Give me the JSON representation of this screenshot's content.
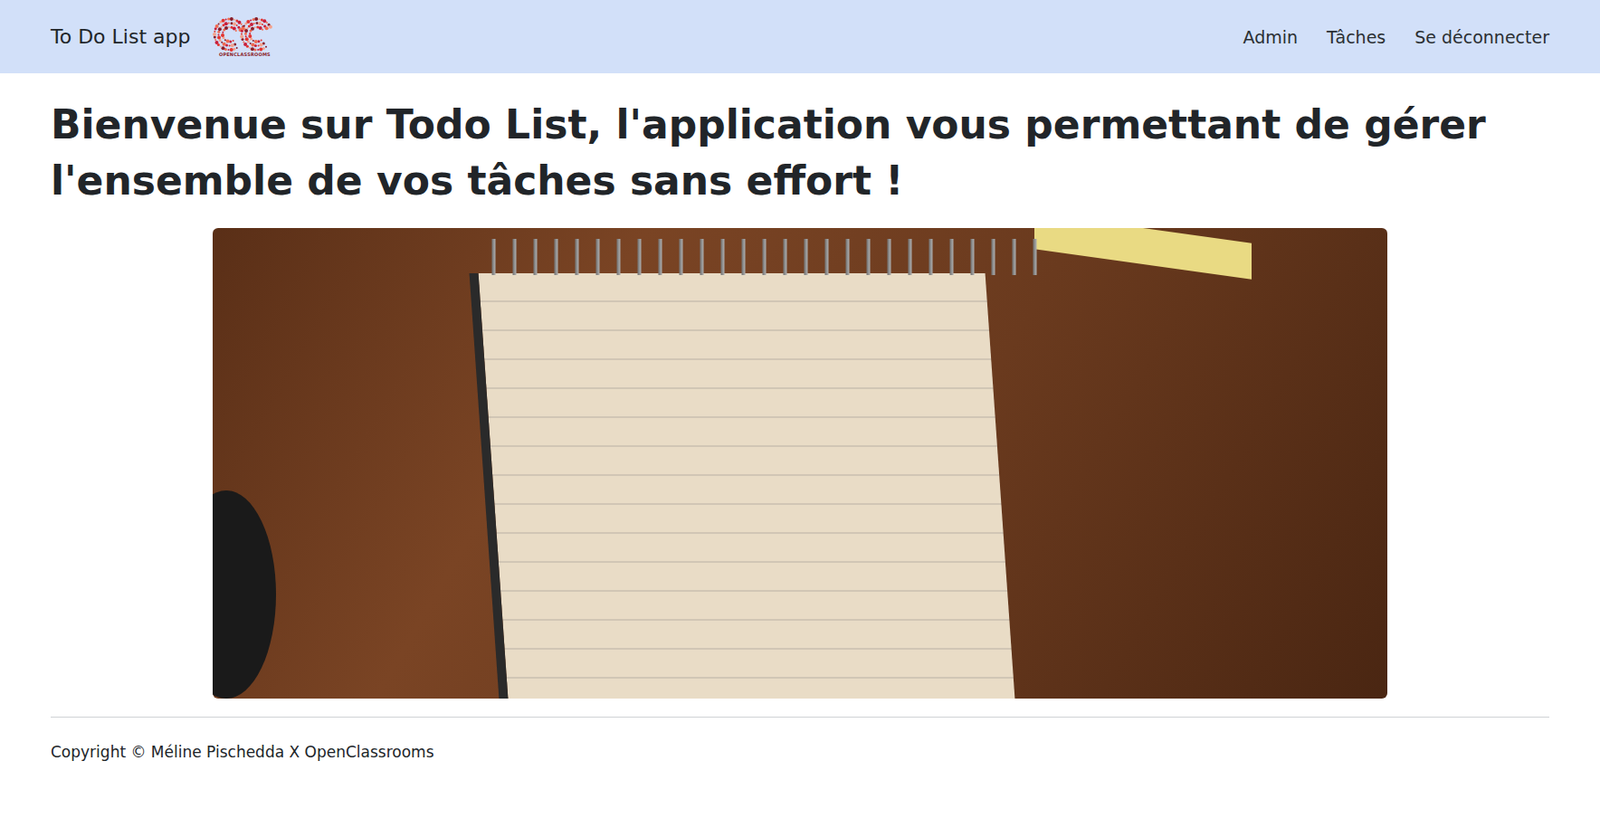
{
  "navbar": {
    "brand": "To Do List app",
    "logo_caption": "OPENCLASSROOMS",
    "links": [
      {
        "label": "Admin"
      },
      {
        "label": "Tâches"
      },
      {
        "label": "Se déconnecter"
      }
    ]
  },
  "heading": "Bienvenue sur Todo List, l'application vous permettant de gérer l'ensemble de vos tâches sans effort !",
  "footer": "Copyright © Méline Pischedda X OpenClassrooms"
}
